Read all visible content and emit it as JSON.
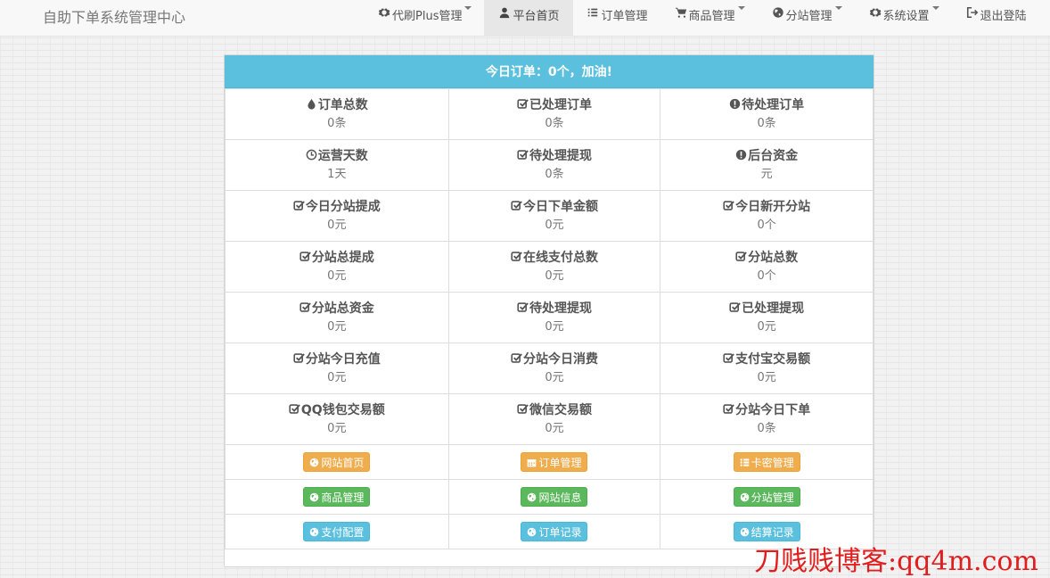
{
  "brand": "自助下单系统管理中心",
  "nav": [
    {
      "label": "代刷Plus管理",
      "icon": "gear-icon",
      "dropdown": true,
      "active": false
    },
    {
      "label": "平台首页",
      "icon": "user-icon",
      "dropdown": false,
      "active": true
    },
    {
      "label": "订单管理",
      "icon": "list-icon",
      "dropdown": false,
      "active": false
    },
    {
      "label": "商品管理",
      "icon": "cart-icon",
      "dropdown": true,
      "active": false
    },
    {
      "label": "分站管理",
      "icon": "globe-icon",
      "dropdown": true,
      "active": false
    },
    {
      "label": "系统设置",
      "icon": "gear-icon",
      "dropdown": true,
      "active": false
    },
    {
      "label": "退出登陆",
      "icon": "logout-icon",
      "dropdown": false,
      "active": false
    }
  ],
  "panel": {
    "heading": "今日订单：0个，加油!"
  },
  "stats": [
    [
      {
        "label": "订单总数",
        "value": "0条",
        "icon": "tint-icon"
      },
      {
        "label": "已处理订单",
        "value": "0条",
        "icon": "check-icon"
      },
      {
        "label": "待处理订单",
        "value": "0条",
        "icon": "exclamation-icon"
      }
    ],
    [
      {
        "label": "运营天数",
        "value": "1天",
        "icon": "clock-icon"
      },
      {
        "label": "待处理提现",
        "value": "0条",
        "icon": "check-icon"
      },
      {
        "label": "后台资金",
        "value": "元",
        "icon": "exclamation-icon"
      }
    ],
    [
      {
        "label": "今日分站提成",
        "value": "0元",
        "icon": "check-icon"
      },
      {
        "label": "今日下单金额",
        "value": "0元",
        "icon": "check-icon"
      },
      {
        "label": "今日新开分站",
        "value": "0个",
        "icon": "check-icon"
      }
    ],
    [
      {
        "label": "分站总提成",
        "value": "0元",
        "icon": "check-icon"
      },
      {
        "label": "在线支付总数",
        "value": "0元",
        "icon": "check-icon"
      },
      {
        "label": "分站总数",
        "value": "0个",
        "icon": "check-icon"
      }
    ],
    [
      {
        "label": "分站总资金",
        "value": "0元",
        "icon": "check-icon"
      },
      {
        "label": "待处理提现",
        "value": "0元",
        "icon": "check-icon"
      },
      {
        "label": "已处理提现",
        "value": "0元",
        "icon": "check-icon"
      }
    ],
    [
      {
        "label": "分站今日充值",
        "value": "0元",
        "icon": "check-icon"
      },
      {
        "label": "分站今日消费",
        "value": "0元",
        "icon": "check-icon"
      },
      {
        "label": "支付宝交易额",
        "value": "0元",
        "icon": "check-icon"
      }
    ],
    [
      {
        "label": "QQ钱包交易额",
        "value": "0元",
        "icon": "check-icon"
      },
      {
        "label": "微信交易额",
        "value": "0元",
        "icon": "check-icon"
      },
      {
        "label": "分站今日下单",
        "value": "0条",
        "icon": "check-icon"
      }
    ]
  ],
  "buttons": [
    [
      {
        "label": "网站首页",
        "icon": "globe-icon",
        "style": "warning"
      },
      {
        "label": "订单管理",
        "icon": "calendar-icon",
        "style": "warning"
      },
      {
        "label": "卡密管理",
        "icon": "list-icon",
        "style": "warning"
      }
    ],
    [
      {
        "label": "商品管理",
        "icon": "globe-icon",
        "style": "success"
      },
      {
        "label": "网站信息",
        "icon": "globe-icon",
        "style": "success"
      },
      {
        "label": "分站管理",
        "icon": "globe-icon",
        "style": "success"
      }
    ],
    [
      {
        "label": "支付配置",
        "icon": "globe-icon",
        "style": "info"
      },
      {
        "label": "订单记录",
        "icon": "globe-icon",
        "style": "info"
      },
      {
        "label": "结算记录",
        "icon": "globe-icon",
        "style": "info"
      }
    ]
  ],
  "watermark": "刀贱贱博客:qq4m.com",
  "colors": {
    "heading": "#5bc0de",
    "warning": "#f0ad4e",
    "success": "#5cb85c",
    "info": "#5bc0de",
    "watermark": "#e21d1d"
  }
}
